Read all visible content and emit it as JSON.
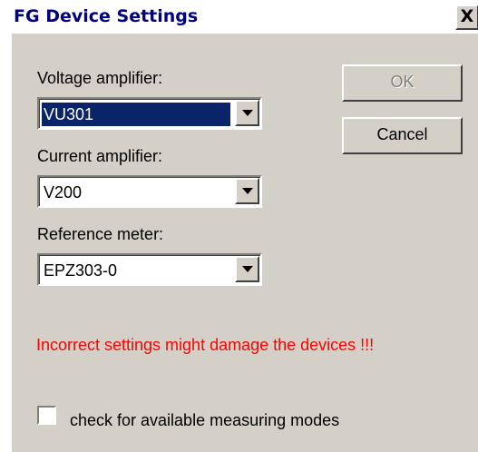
{
  "window": {
    "title": "FG Device Settings",
    "close_glyph": "X"
  },
  "fields": {
    "voltage_amplifier": {
      "label": "Voltage amplifier:",
      "value": "VU301"
    },
    "current_amplifier": {
      "label": "Current amplifier:",
      "value": "V200"
    },
    "reference_meter": {
      "label": "Reference meter:",
      "value": "EPZ303-0"
    }
  },
  "buttons": {
    "ok": "OK",
    "cancel": "Cancel"
  },
  "warning": "Incorrect settings might damage the devices !!!",
  "checkbox": {
    "label": "check for available measuring modes",
    "checked": false
  },
  "colors": {
    "face": "#d4d0c8",
    "title_text": "#000080",
    "selection": "#0a246a",
    "warning": "#ff0000"
  }
}
